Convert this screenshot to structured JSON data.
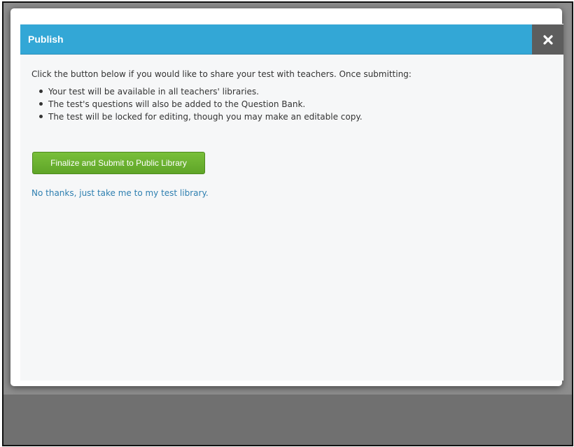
{
  "dialog": {
    "title": "Publish",
    "close_icon": "close-icon",
    "intro": "Click the button below if you would like to share your test with teachers. Once submitting:",
    "bullets": [
      "Your test will be available in all teachers' libraries.",
      "The test's questions will also be added to the Question Bank.",
      "The test will be locked for editing, though you may make an editable copy."
    ],
    "submit_label": "Finalize and Submit to Public Library",
    "decline_link": "No thanks, just take me to my test library."
  },
  "colors": {
    "titlebar": "#33a7d6",
    "close_button": "#5d5d5d",
    "submit_button": "#6cb232",
    "link": "#2e7fb0",
    "overlay": "#8d8d8d"
  }
}
